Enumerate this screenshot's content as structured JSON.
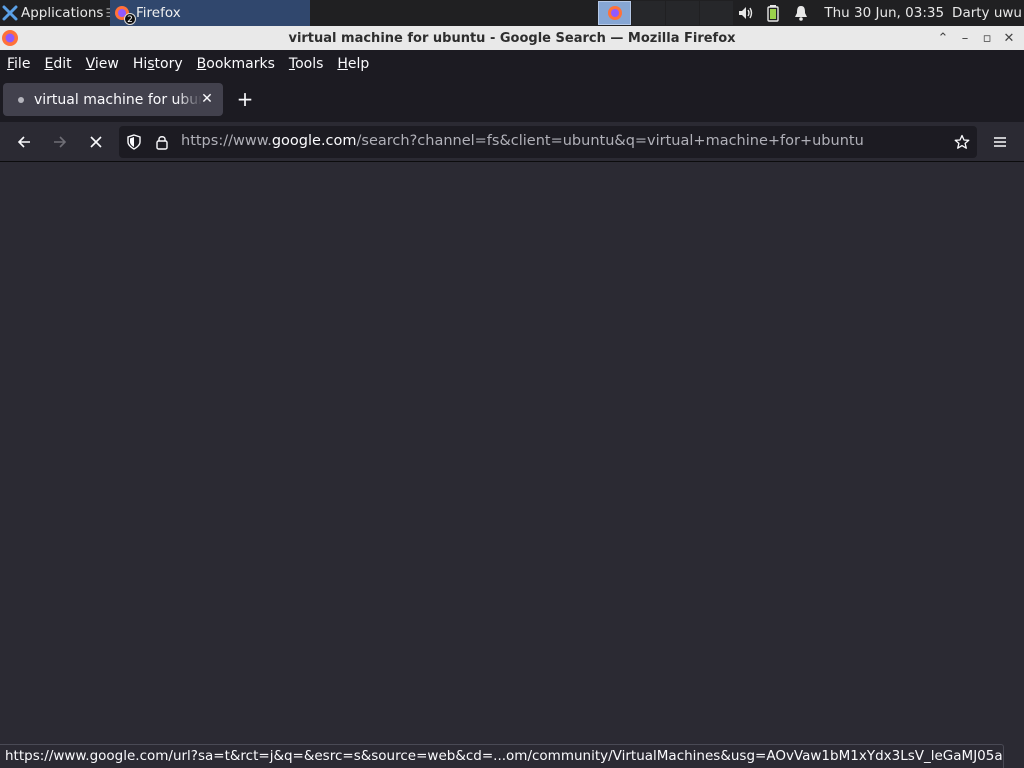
{
  "panel": {
    "applications_label": "Applications",
    "task_label": "Firefox",
    "task_badge": "2",
    "clock": "Thu 30 Jun, 03:35",
    "user": "Darty uwu"
  },
  "window": {
    "title": "virtual machine for ubuntu - Google Search — Mozilla Firefox"
  },
  "menubar": {
    "items": [
      {
        "accel": "F",
        "rest": "ile"
      },
      {
        "accel": "E",
        "rest": "dit"
      },
      {
        "accel": "V",
        "rest": "iew"
      },
      {
        "pre": "Hi",
        "accel": "s",
        "rest": "tory"
      },
      {
        "accel": "B",
        "rest": "ookmarks"
      },
      {
        "accel": "T",
        "rest": "ools"
      },
      {
        "accel": "H",
        "rest": "elp"
      }
    ]
  },
  "tab": {
    "title": "virtual machine for ubuntu - Google Search"
  },
  "urlbar": {
    "prefix": "https://www.",
    "domain": "google.com",
    "path": "/search?channel=fs&client=ubuntu&q=virtual+machine+for+ubuntu"
  },
  "status": {
    "link": "https://www.google.com/url?sa=t&rct=j&q=&esrc=s&source=web&cd=...om/community/VirtualMachines&usg=AOvVaw1bM1xYdx3LsV_leGaMJ05a"
  },
  "colors": {
    "panel_bg": "#202022",
    "task_active": "#30476d",
    "chrome_bg": "#1c1b22",
    "toolbar_bg": "#2b2a33",
    "tab_active": "#42414d"
  }
}
